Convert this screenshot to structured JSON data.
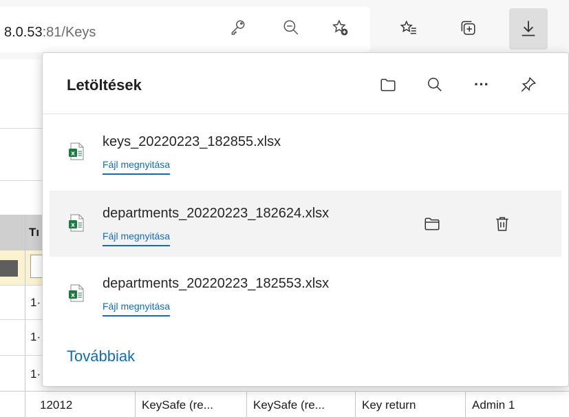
{
  "browser": {
    "url_host": "8.0.53",
    "url_rest": ":81/Keys",
    "icons": [
      "key-icon",
      "zoom-out-icon",
      "add-favorite-icon",
      "favorites-icon",
      "collections-icon",
      "downloads-icon"
    ]
  },
  "downloads": {
    "title": "Letöltések",
    "header_icons": [
      "open-folder-icon",
      "search-icon",
      "more-icon",
      "pin-icon"
    ],
    "more_glyph": "···",
    "items": [
      {
        "filename": "keys_20220223_182855.xlsx",
        "action": "Fájl megnyitása",
        "file_type": "excel-icon"
      },
      {
        "filename": "departments_20220223_182624.xlsx",
        "action": "Fájl megnyitása",
        "file_type": "excel-icon"
      },
      {
        "filename": "departments_20220223_182553.xlsx",
        "action": "Fájl megnyitása",
        "file_type": "excel-icon"
      }
    ],
    "see_more": "Továbbiak"
  },
  "background_table": {
    "header_fragment": "Tı",
    "row_fragments": [
      "1·",
      "1·",
      "1·"
    ],
    "last_row": [
      "12012",
      "KeySafe (re...",
      "KeySafe (re...",
      "Key return",
      "Admin 1"
    ]
  },
  "colors": {
    "accent": "#0f6cbd",
    "excel_green": "#1d7a45",
    "hover_row": "#f3f3f3",
    "filter_row": "#fbf3cf"
  }
}
